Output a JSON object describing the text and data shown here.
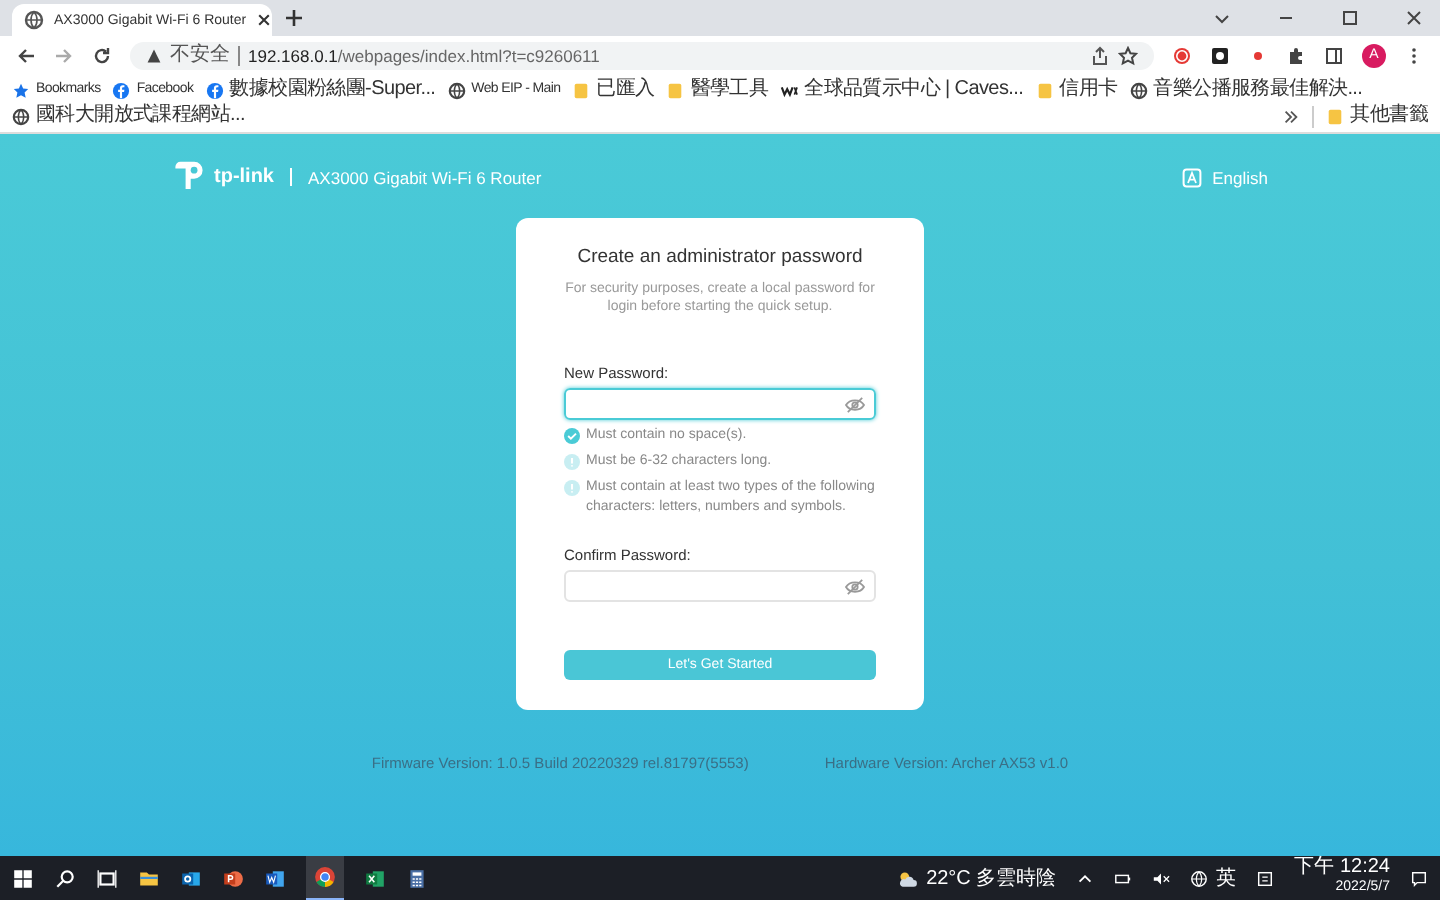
{
  "browser": {
    "tab_title": "AX3000 Gigabit Wi-Fi 6 Router",
    "security_label": "不安全",
    "url_host": "192.168.0.1",
    "url_path": "/webpages/index.html?t=c9260611",
    "profile_initial": "A",
    "bookmarks": [
      {
        "label": "Bookmarks",
        "kind": "star"
      },
      {
        "label": "Facebook",
        "kind": "facebook"
      },
      {
        "label": "數據校園粉絲團-Super...",
        "kind": "facebook"
      },
      {
        "label": "Web EIP - Main",
        "kind": "globe"
      },
      {
        "label": "已匯入",
        "kind": "folder"
      },
      {
        "label": "醫學工具",
        "kind": "folder"
      },
      {
        "label": "全球品質示中心 | Caves...",
        "kind": "wix"
      },
      {
        "label": "信用卡",
        "kind": "folder"
      },
      {
        "label": "音樂公播服務最佳解決...",
        "kind": "globe"
      },
      {
        "label": "國科大開放式課程網站...",
        "kind": "globe"
      }
    ],
    "other_bookmarks": "其他書籤"
  },
  "header": {
    "brand": "tp-link",
    "product": "AX3000 Gigabit Wi-Fi 6 Router",
    "language": "English"
  },
  "card": {
    "title": "Create an administrator password",
    "subtitle": "For security purposes, create a local password for login before starting the quick setup.",
    "new_password": {
      "label": "New Password:",
      "focused": true
    },
    "rules": [
      {
        "text": "Must contain no space(s).",
        "met": true
      },
      {
        "text": "Must be 6-32 characters long.",
        "met": false
      },
      {
        "text": "Must contain at least two types of the following characters: letters, numbers and symbols.",
        "met": false
      }
    ],
    "confirm_password": {
      "label": "Confirm Password:",
      "focused": false
    },
    "button": "Let's Get Started"
  },
  "footer": {
    "firmware": "Firmware Version: 1.0.5 Build 20220329 rel.81797(5553)",
    "hardware": "Hardware Version: Archer AX53 v1.0"
  },
  "taskbar": {
    "weather": "22°C 多雲時陰",
    "ime": "英",
    "time": "下午 12:24",
    "date": "2022/5/7"
  }
}
